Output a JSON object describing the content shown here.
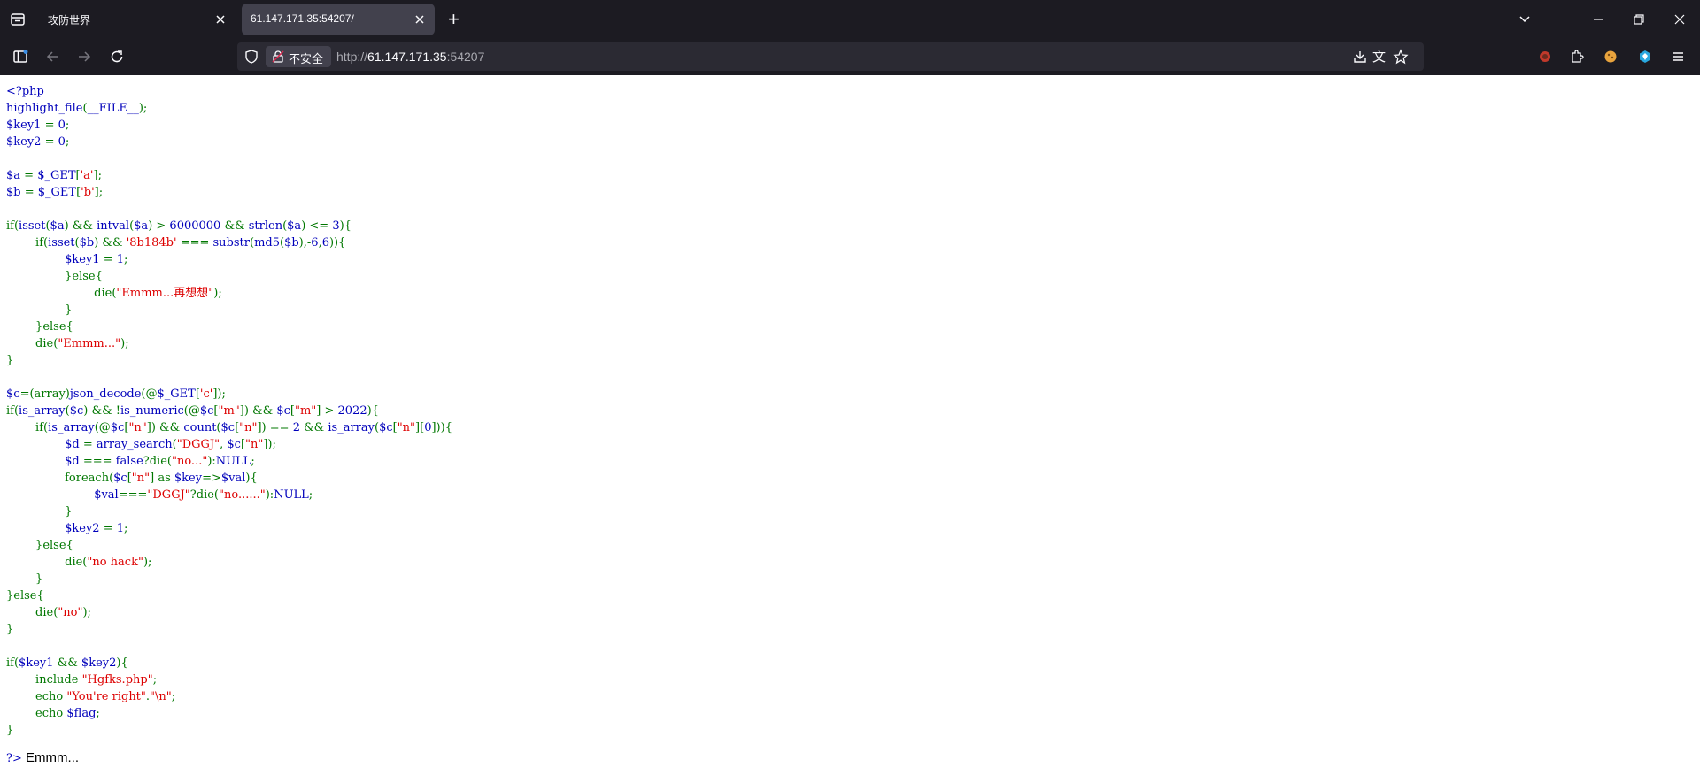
{
  "browser": {
    "tabs": [
      {
        "title": "攻防世界",
        "active": false
      },
      {
        "title": "61.147.171.35:54207/",
        "active": true
      }
    ],
    "new_tab_symbol": "+",
    "security_badge": "不安全",
    "url": {
      "prefix": "http://",
      "host": "61.147.171.35",
      "port": ":54207"
    }
  },
  "code_lines": [
    [
      [
        "h",
        "<?php"
      ]
    ],
    [
      [
        "h",
        "highlight_file"
      ],
      [
        "k",
        "("
      ],
      [
        "h",
        "__FILE__"
      ],
      [
        "k",
        ");"
      ]
    ],
    [
      [
        "h",
        "$key1 "
      ],
      [
        "k",
        "= "
      ],
      [
        "h",
        "0"
      ],
      [
        "k",
        ";"
      ]
    ],
    [
      [
        "h",
        "$key2 "
      ],
      [
        "k",
        "= "
      ],
      [
        "h",
        "0"
      ],
      [
        "k",
        ";"
      ]
    ],
    [],
    [
      [
        "h",
        "$a "
      ],
      [
        "k",
        "= "
      ],
      [
        "h",
        "$_GET"
      ],
      [
        "k",
        "["
      ],
      [
        "s",
        "'a'"
      ],
      [
        "k",
        "];"
      ]
    ],
    [
      [
        "h",
        "$b "
      ],
      [
        "k",
        "= "
      ],
      [
        "h",
        "$_GET"
      ],
      [
        "k",
        "["
      ],
      [
        "s",
        "'b'"
      ],
      [
        "k",
        "];"
      ]
    ],
    [],
    [
      [
        "k",
        "if("
      ],
      [
        "h",
        "isset"
      ],
      [
        "k",
        "("
      ],
      [
        "h",
        "$a"
      ],
      [
        "k",
        ") && "
      ],
      [
        "h",
        "intval"
      ],
      [
        "k",
        "("
      ],
      [
        "h",
        "$a"
      ],
      [
        "k",
        ") > "
      ],
      [
        "h",
        "6000000 "
      ],
      [
        "k",
        "&& "
      ],
      [
        "h",
        "strlen"
      ],
      [
        "k",
        "("
      ],
      [
        "h",
        "$a"
      ],
      [
        "k",
        ") <= "
      ],
      [
        "h",
        "3"
      ],
      [
        "k",
        "){"
      ]
    ],
    [
      [
        "k",
        "        if("
      ],
      [
        "h",
        "isset"
      ],
      [
        "k",
        "("
      ],
      [
        "h",
        "$b"
      ],
      [
        "k",
        ") && "
      ],
      [
        "s",
        "'8b184b' "
      ],
      [
        "k",
        "=== "
      ],
      [
        "h",
        "substr"
      ],
      [
        "k",
        "("
      ],
      [
        "h",
        "md5"
      ],
      [
        "k",
        "("
      ],
      [
        "h",
        "$b"
      ],
      [
        "k",
        "),-"
      ],
      [
        "h",
        "6"
      ],
      [
        "k",
        ","
      ],
      [
        "h",
        "6"
      ],
      [
        "k",
        ")){"
      ]
    ],
    [
      [
        "k",
        "                "
      ],
      [
        "h",
        "$key1 "
      ],
      [
        "k",
        "= "
      ],
      [
        "h",
        "1"
      ],
      [
        "k",
        ";"
      ]
    ],
    [
      [
        "k",
        "                }else{"
      ]
    ],
    [
      [
        "k",
        "                        die("
      ],
      [
        "s",
        "\"Emmm...再想想\""
      ],
      [
        "k",
        ");"
      ]
    ],
    [
      [
        "k",
        "                }"
      ]
    ],
    [
      [
        "k",
        "        }else{"
      ]
    ],
    [
      [
        "k",
        "        die("
      ],
      [
        "s",
        "\"Emmm...\""
      ],
      [
        "k",
        ");"
      ]
    ],
    [
      [
        "k",
        "}"
      ]
    ],
    [],
    [
      [
        "h",
        "$c"
      ],
      [
        "k",
        "=(array)"
      ],
      [
        "h",
        "json_decode"
      ],
      [
        "k",
        "(@"
      ],
      [
        "h",
        "$_GET"
      ],
      [
        "k",
        "["
      ],
      [
        "s",
        "'c'"
      ],
      [
        "k",
        "]);"
      ]
    ],
    [
      [
        "k",
        "if("
      ],
      [
        "h",
        "is_array"
      ],
      [
        "k",
        "("
      ],
      [
        "h",
        "$c"
      ],
      [
        "k",
        ") && !"
      ],
      [
        "h",
        "is_numeric"
      ],
      [
        "k",
        "(@"
      ],
      [
        "h",
        "$c"
      ],
      [
        "k",
        "["
      ],
      [
        "s",
        "\"m\""
      ],
      [
        "k",
        "]) && "
      ],
      [
        "h",
        "$c"
      ],
      [
        "k",
        "["
      ],
      [
        "s",
        "\"m\""
      ],
      [
        "k",
        "] > "
      ],
      [
        "h",
        "2022"
      ],
      [
        "k",
        "){"
      ]
    ],
    [
      [
        "k",
        "        if("
      ],
      [
        "h",
        "is_array"
      ],
      [
        "k",
        "(@"
      ],
      [
        "h",
        "$c"
      ],
      [
        "k",
        "["
      ],
      [
        "s",
        "\"n\""
      ],
      [
        "k",
        "]) && "
      ],
      [
        "h",
        "count"
      ],
      [
        "k",
        "("
      ],
      [
        "h",
        "$c"
      ],
      [
        "k",
        "["
      ],
      [
        "s",
        "\"n\""
      ],
      [
        "k",
        "]) == "
      ],
      [
        "h",
        "2 "
      ],
      [
        "k",
        "&& "
      ],
      [
        "h",
        "is_array"
      ],
      [
        "k",
        "("
      ],
      [
        "h",
        "$c"
      ],
      [
        "k",
        "["
      ],
      [
        "s",
        "\"n\""
      ],
      [
        "k",
        "]["
      ],
      [
        "h",
        "0"
      ],
      [
        "k",
        "])){"
      ]
    ],
    [
      [
        "k",
        "                "
      ],
      [
        "h",
        "$d "
      ],
      [
        "k",
        "= "
      ],
      [
        "h",
        "array_search"
      ],
      [
        "k",
        "("
      ],
      [
        "s",
        "\"DGGJ\""
      ],
      [
        "k",
        ", "
      ],
      [
        "h",
        "$c"
      ],
      [
        "k",
        "["
      ],
      [
        "s",
        "\"n\""
      ],
      [
        "k",
        "]);"
      ]
    ],
    [
      [
        "k",
        "                "
      ],
      [
        "h",
        "$d "
      ],
      [
        "k",
        "=== "
      ],
      [
        "h",
        "false"
      ],
      [
        "k",
        "?die("
      ],
      [
        "s",
        "\"no...\""
      ],
      [
        "k",
        "):"
      ],
      [
        "h",
        "NULL"
      ],
      [
        "k",
        ";"
      ]
    ],
    [
      [
        "k",
        "                foreach("
      ],
      [
        "h",
        "$c"
      ],
      [
        "k",
        "["
      ],
      [
        "s",
        "\"n\""
      ],
      [
        "k",
        "] as "
      ],
      [
        "h",
        "$key"
      ],
      [
        "k",
        "=>"
      ],
      [
        "h",
        "$val"
      ],
      [
        "k",
        "){"
      ]
    ],
    [
      [
        "k",
        "                        "
      ],
      [
        "h",
        "$val"
      ],
      [
        "k",
        "==="
      ],
      [
        "s",
        "\"DGGJ\""
      ],
      [
        "k",
        "?die("
      ],
      [
        "s",
        "\"no......\""
      ],
      [
        "k",
        "):"
      ],
      [
        "h",
        "NULL"
      ],
      [
        "k",
        ";"
      ]
    ],
    [
      [
        "k",
        "                }"
      ]
    ],
    [
      [
        "k",
        "                "
      ],
      [
        "h",
        "$key2 "
      ],
      [
        "k",
        "= "
      ],
      [
        "h",
        "1"
      ],
      [
        "k",
        ";"
      ]
    ],
    [
      [
        "k",
        "        }else{"
      ]
    ],
    [
      [
        "k",
        "                die("
      ],
      [
        "s",
        "\"no hack\""
      ],
      [
        "k",
        ");"
      ]
    ],
    [
      [
        "k",
        "        }"
      ]
    ],
    [
      [
        "k",
        "}else{"
      ]
    ],
    [
      [
        "k",
        "        die("
      ],
      [
        "s",
        "\"no\""
      ],
      [
        "k",
        ");"
      ]
    ],
    [
      [
        "k",
        "}"
      ]
    ],
    [],
    [
      [
        "k",
        "if("
      ],
      [
        "h",
        "$key1 "
      ],
      [
        "k",
        "&& "
      ],
      [
        "h",
        "$key2"
      ],
      [
        "k",
        "){"
      ]
    ],
    [
      [
        "k",
        "        include "
      ],
      [
        "s",
        "\"Hgfks.php\""
      ],
      [
        "k",
        ";"
      ]
    ],
    [
      [
        "k",
        "        echo "
      ],
      [
        "s",
        "\"You're right\""
      ],
      [
        "k",
        "."
      ],
      [
        "s",
        "\"\\n\""
      ],
      [
        "k",
        ";"
      ]
    ],
    [
      [
        "k",
        "        echo "
      ],
      [
        "h",
        "$flag"
      ],
      [
        "k",
        ";"
      ]
    ],
    [
      [
        "k",
        "}"
      ]
    ]
  ],
  "output": {
    "tag": "?>",
    "text": " Emmm..."
  }
}
